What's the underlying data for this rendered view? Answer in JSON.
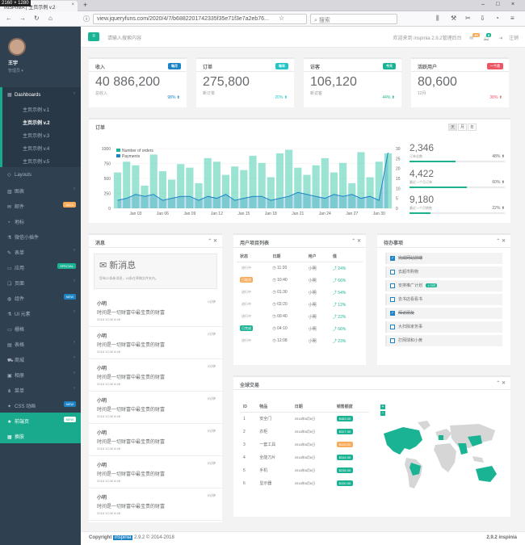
{
  "browser": {
    "dims": "2160 × 1280",
    "tab_title": "INSPINIA | 主页示例 v.2",
    "url": "view.jqueryfuns.com/2020/4/7/b6882201742335f35e71f3e7a2eb76...",
    "search_placeholder": "搜索"
  },
  "sidebar": {
    "user_name": "王宇",
    "user_role": "管理员",
    "items": [
      {
        "label": "Dashboards",
        "icon": "th-large-icon",
        "active": true
      },
      {
        "label": "主页示例 v.1",
        "sub": true
      },
      {
        "label": "主页示例 v.2",
        "sub": true,
        "current": true
      },
      {
        "label": "主页示例 v.3",
        "sub": true
      },
      {
        "label": "主页示例 v.4",
        "sub": true
      },
      {
        "label": "主页示例 v.5",
        "sub": true
      },
      {
        "label": "Layouts",
        "icon": "diamond-icon"
      },
      {
        "label": "图表",
        "icon": "bar-chart-icon",
        "chevron": true
      },
      {
        "label": "邮件",
        "icon": "envelope-icon",
        "badge": "16/24",
        "badge_color": "#f8ac59"
      },
      {
        "label": "地标",
        "icon": "pie-chart-icon"
      },
      {
        "label": "微信小插件",
        "icon": "flask-icon"
      },
      {
        "label": "表单",
        "icon": "edit-icon",
        "chevron": true
      },
      {
        "label": "应用",
        "icon": "desktop-icon",
        "badge": "SPECIAL",
        "badge_color": "#1ab394"
      },
      {
        "label": "页面",
        "icon": "files-icon",
        "chevron": true
      },
      {
        "label": "组件",
        "icon": "globe-icon",
        "badge": "NEW",
        "badge_color": "#1c84c6"
      },
      {
        "label": "UI 元素",
        "icon": "flask-icon",
        "chevron": true
      },
      {
        "label": "栅格",
        "icon": "laptop-icon"
      },
      {
        "label": "表格",
        "icon": "table-icon",
        "chevron": true
      },
      {
        "label": "商城",
        "icon": "shopping-cart-icon",
        "chevron": true
      },
      {
        "label": "相册",
        "icon": "picture-icon",
        "chevron": true
      },
      {
        "label": "菜单",
        "icon": "sitemap-icon",
        "chevron": true
      },
      {
        "label": "CSS 动画",
        "icon": "magic-icon",
        "badge": "NEW",
        "badge_color": "#1c84c6"
      },
      {
        "label": "前端页",
        "icon": "star-icon",
        "badge": "NEW",
        "badge_color": "#fff",
        "green": true
      },
      {
        "label": "换肤",
        "icon": "th-icon",
        "green": true
      }
    ]
  },
  "topnav": {
    "search_placeholder": "请输入搜索内容",
    "welcome": "欢迎来到 inspinia 2.9.2管理后台",
    "mail_count": "16",
    "bell_count": "8",
    "logout": "注销"
  },
  "stats": [
    {
      "title": "收入",
      "label": "每月",
      "label_color": "#1c84c6",
      "value": "40 886,200",
      "sub": "总收入",
      "pct": "98%",
      "pct_color": "#1c84c6"
    },
    {
      "title": "订单",
      "label": "每年",
      "label_color": "#23c6c8",
      "value": "275,800",
      "sub": "新订单",
      "pct": "20%",
      "pct_color": "#23c6c8"
    },
    {
      "title": "访客",
      "label": "今天",
      "label_color": "#1ab394",
      "value": "106,120",
      "sub": "新访客",
      "pct": "44%",
      "pct_color": "#1ab394"
    },
    {
      "title": "活跃用户",
      "label": "一个月",
      "label_color": "#ed5565",
      "value": "80,600",
      "sub": "12月",
      "pct": "38%",
      "pct_color": "#ed5565"
    }
  ],
  "orders": {
    "title": "订单",
    "buttons": [
      "天",
      "月",
      "年"
    ],
    "legend": [
      "Number of orders",
      "Payments"
    ],
    "stats": [
      {
        "value": "2,346",
        "label": "订单总数",
        "pct": "48%",
        "fill": 0.48
      },
      {
        "value": "4,422",
        "label": "最近一个月订单",
        "pct": "60%",
        "fill": 0.6
      },
      {
        "value": "9,180",
        "label": "最近一个月销售",
        "pct": "22%",
        "fill": 0.22
      }
    ]
  },
  "chart_data": {
    "type": "bar",
    "x_tick_labels": [
      "Jan 03",
      "Jan 06",
      "Jan 09",
      "Jan 12",
      "Jan 15",
      "Jan 18",
      "Jan 21",
      "Jan 24",
      "Jan 27",
      "Jan 30"
    ],
    "y_left_ticks": [
      "0",
      "250",
      "500",
      "750",
      "1000"
    ],
    "y_right_ticks": [
      "0",
      "5",
      "10",
      "15",
      "20",
      "25",
      "30"
    ],
    "series": [
      {
        "name": "Number of orders",
        "values": [
          600,
          780,
          720,
          380,
          900,
          620,
          480,
          740,
          680,
          420,
          840,
          780,
          560,
          700,
          640,
          880,
          760,
          520,
          920,
          980,
          680,
          560,
          720,
          840,
          600,
          760,
          420,
          940,
          520,
          780,
          920
        ]
      },
      {
        "name": "Payments",
        "values": [
          4,
          5,
          7,
          6,
          7,
          4,
          5,
          6,
          6,
          4,
          6,
          5,
          7,
          4,
          5,
          6,
          6,
          4,
          5,
          6,
          8,
          7,
          6,
          5,
          7,
          6,
          7,
          5,
          6,
          4,
          28
        ]
      }
    ]
  },
  "messages": {
    "title": "消息",
    "header": "新消息",
    "header_sub": "您有22条新消息，16条在草稿文件夹内。",
    "items": [
      {
        "name": "小明",
        "text": "时间是一切财富中最宝贵的财富",
        "time": "2018.10.06 8:48",
        "age": "1分钟"
      },
      {
        "name": "小明",
        "text": "时间是一切财富中最宝贵的财富",
        "time": "2018.10.06 8:48",
        "age": "2分钟"
      },
      {
        "name": "小明",
        "text": "时间是一切财富中最宝贵的财富",
        "time": "2018.10.06 8:48",
        "age": "3分钟"
      },
      {
        "name": "小明",
        "text": "时间是一切财富中最宝贵的财富",
        "time": "2018.10.06 8:48",
        "age": "5分钟"
      },
      {
        "name": "小明",
        "text": "时间是一切财富中最宝贵的财富",
        "time": "2018.10.06 8:48",
        "age": "5分钟"
      },
      {
        "name": "小明",
        "text": "时间是一切财富中最宝贵的财富",
        "time": "2018.10.06 8:48",
        "age": "5分钟"
      },
      {
        "name": "小明",
        "text": "时间是一切财富中最宝贵的财富",
        "time": "2018.10.06 8:48",
        "age": "5分钟"
      }
    ]
  },
  "projects": {
    "title": "用户项目列表",
    "headers": [
      "状态",
      "日期",
      "用户",
      "值"
    ],
    "rows": [
      {
        "status": "进行中",
        "date": "11:20",
        "user": "小明",
        "value": "24%",
        "hl": ""
      },
      {
        "status": "已取消",
        "date": "10:40",
        "user": "小明",
        "value": "66%",
        "hl": "#f8ac59"
      },
      {
        "status": "进行中",
        "date": "01:30",
        "user": "小明",
        "value": "54%",
        "hl": ""
      },
      {
        "status": "进行中",
        "date": "02:20",
        "user": "小明",
        "value": "12%",
        "hl": ""
      },
      {
        "status": "进行中",
        "date": "09:40",
        "user": "小明",
        "value": "22%",
        "hl": ""
      },
      {
        "status": "已完成",
        "date": "04:10",
        "user": "小明",
        "value": "66%",
        "hl": "#1ab394"
      },
      {
        "status": "进行中",
        "date": "12:08",
        "user": "小明",
        "value": "23%",
        "hl": ""
      }
    ]
  },
  "todos": {
    "title": "待办事项",
    "items": [
      {
        "text": "完成网站前端",
        "checked": true
      },
      {
        "text": "去超市购物",
        "checked": false
      },
      {
        "text": "安排推广计划",
        "checked": false,
        "badge": "1小时"
      },
      {
        "text": "去书店看看书",
        "checked": false
      },
      {
        "text": "拜访朋友",
        "checked": true
      },
      {
        "text": "大扫除家务事",
        "checked": false
      },
      {
        "text": "打网球和小黄",
        "checked": false
      }
    ]
  },
  "sales": {
    "title": "全球交易",
    "headers": [
      "ID",
      "物品",
      "日期",
      "销售额度"
    ],
    "rows": [
      {
        "id": "1",
        "item": "安全门",
        "date": "2018年6月6日",
        "amount": "$483.00",
        "color": "#1ab394"
      },
      {
        "id": "2",
        "item": "衣柜",
        "date": "2018年6月6日",
        "amount": "$327.00",
        "color": "#1ab394"
      },
      {
        "id": "3",
        "item": "一套工具",
        "date": "2018年6月6日",
        "amount": "$125.00",
        "color": "#f8ac59"
      },
      {
        "id": "4",
        "item": "全能刀片",
        "date": "2018年6月6日",
        "amount": "$344.00",
        "color": "#1ab394"
      },
      {
        "id": "5",
        "item": "手机",
        "date": "2018年6月6日",
        "amount": "$235.00",
        "color": "#1ab394"
      },
      {
        "id": "6",
        "item": "显示器",
        "date": "2018年6月6日",
        "amount": "$100.00",
        "color": "#1ab394"
      }
    ]
  },
  "footer": {
    "copyright": "Copyright",
    "brand": "inspinia",
    "rest": "2.9.2 © 2014-2018",
    "version": "2.9.2 inspinia"
  }
}
